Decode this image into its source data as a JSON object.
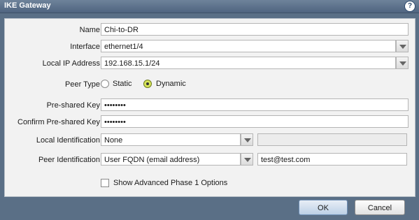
{
  "window": {
    "title": "IKE Gateway",
    "help_icon": "question-icon"
  },
  "form": {
    "name": {
      "label": "Name",
      "value": "Chi-to-DR"
    },
    "interface": {
      "label": "Interface",
      "value": "ethernet1/4"
    },
    "local_ip": {
      "label": "Local IP Address",
      "value": "192.168.15.1/24"
    },
    "peer_type": {
      "label": "Peer Type",
      "options": [
        "Static",
        "Dynamic"
      ],
      "selected": "Dynamic"
    },
    "psk": {
      "label": "Pre-shared Key",
      "value": "••••••••"
    },
    "confirm_psk": {
      "label": "Confirm Pre-shared Key",
      "value": "••••••••"
    },
    "local_id": {
      "label": "Local Identification",
      "value": "None",
      "extra": ""
    },
    "peer_id": {
      "label": "Peer Identification",
      "value": "User FQDN (email address)",
      "extra": "test@test.com"
    },
    "advanced": {
      "label": "Show Advanced Phase 1 Options",
      "checked": false
    }
  },
  "buttons": {
    "ok": "OK",
    "cancel": "Cancel"
  },
  "colors": {
    "frame": "#5a6f86",
    "panel": "#f2f2f2",
    "radio_selected": "#d7e55a"
  }
}
